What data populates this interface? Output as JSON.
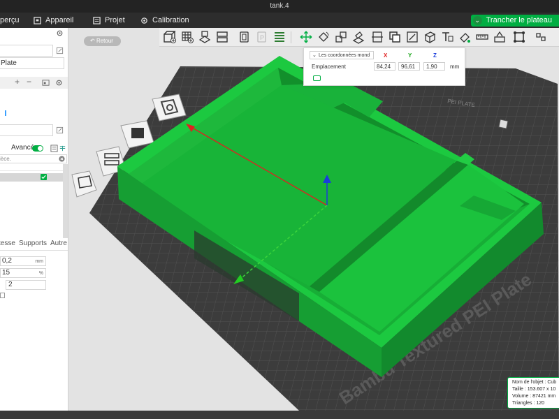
{
  "window": {
    "title": "tank.4"
  },
  "menu": {
    "items": [
      {
        "label": "perçu",
        "icon": "preview-icon"
      },
      {
        "label": "Appareil",
        "icon": "printer-icon"
      },
      {
        "label": "Projet",
        "icon": "project-icon"
      },
      {
        "label": "Calibration",
        "icon": "calibration-icon"
      }
    ],
    "slice_button": "Trancher le plateau"
  },
  "left_panel": {
    "plate_label": "Plate",
    "advanced_label": "Avancé",
    "search_placeholder": "ièce.",
    "tabs": [
      "tesse",
      "Supports",
      "Autre"
    ],
    "fields": [
      {
        "value": "0,2",
        "unit": "mm"
      },
      {
        "value": "15",
        "unit": "%"
      },
      {
        "value": "2",
        "unit": ""
      }
    ],
    "toolbar_symbols": [
      "+",
      "−"
    ]
  },
  "viewport": {
    "back_button": "Retour",
    "coordinates": {
      "mode_label": "Les coordonnées mond",
      "headers": [
        "X",
        "Y",
        "Z"
      ],
      "row_label": "Emplacement",
      "values": [
        "84,24",
        "96,61",
        "1,90"
      ],
      "unit": "mm"
    },
    "object_info": {
      "name": "Nom de l'objet : Cub",
      "size": "Taille : 153.607 x 10",
      "volume": "Volume : 87421 mm",
      "triangles": "Triangles : 120"
    },
    "plate_text": "Bambu Textured PEI Plate",
    "plate_corner_text": "PEI PLATE"
  },
  "colors": {
    "accent": "#00ae42",
    "model": "#16b83c",
    "plate": "#3c3c3c",
    "axis_x": "#e02020",
    "axis_y": "#16c216",
    "axis_z": "#1a3ddb"
  }
}
